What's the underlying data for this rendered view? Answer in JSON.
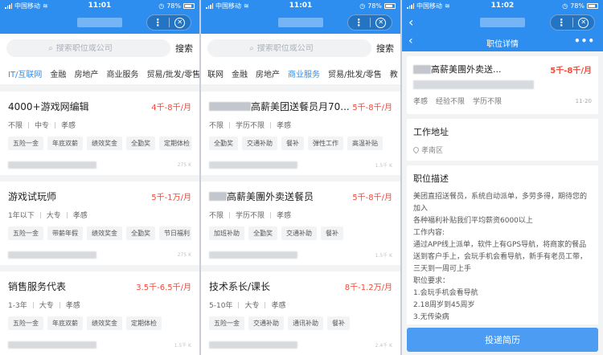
{
  "status": {
    "carrier": "中国移动",
    "battery": "78%",
    "time_1": "11:01",
    "time_2": "11:01",
    "time_3": "11:02"
  },
  "capsule": {
    "more": "⋮",
    "close": "✕"
  },
  "search": {
    "placeholder": "搜索职位或公司",
    "button": "搜索"
  },
  "tabs_panel1": [
    "IT/互联网",
    "金融",
    "房地产",
    "商业服务",
    "贸易/批发/零售"
  ],
  "tabs_panel2": [
    "联网",
    "金融",
    "房地产",
    "商业服务",
    "贸易/批发/零售",
    "教"
  ],
  "jobs_panel1": [
    {
      "title": "4000+游戏网编辑",
      "salary": "4千-8千/月",
      "meta": [
        "不限",
        "中专",
        "孝感"
      ],
      "tags": [
        "五险一金",
        "年底双薪",
        "绩效奖金",
        "全勤奖",
        "定期体检"
      ],
      "dist": "275 K"
    },
    {
      "title": "游戏试玩师",
      "salary": "5千-1万/月",
      "meta": [
        "1年以下",
        "大专",
        "孝感"
      ],
      "tags": [
        "五险一金",
        "带薪年假",
        "绩效奖金",
        "全勤奖",
        "节日福利"
      ],
      "dist": "275 K"
    },
    {
      "title": "销售服务代表",
      "salary": "3.5千-6.5千/月",
      "meta": [
        "1-3年",
        "大专",
        "孝感"
      ],
      "tags": [
        "五险一金",
        "年底双薪",
        "绩效奖金",
        "定期体检"
      ],
      "dist": "1.5千 K"
    }
  ],
  "jobs_panel2": [
    {
      "title": "高薪美团送餐员月70...",
      "salary": "5千-8千/月",
      "meta": [
        "不限",
        "学历不限",
        "孝感"
      ],
      "tags": [
        "全勤奖",
        "交通补助",
        "餐补",
        "弹性工作",
        "高温补贴"
      ],
      "dist": "1.5千 K"
    },
    {
      "title": "高薪美團外卖送餐员",
      "salary": "5千-8千/月",
      "meta": [
        "不限",
        "学历不限",
        "孝感"
      ],
      "tags": [
        "加班补助",
        "全勤奖",
        "交通补助",
        "餐补"
      ],
      "dist": "1.5千 K"
    },
    {
      "title": "技术系长/课长",
      "salary": "8千-1.2万/月",
      "meta": [
        "5-10年",
        "大专",
        "孝感"
      ],
      "tags": [
        "五险一金",
        "交通补助",
        "通讯补助",
        "餐补"
      ],
      "dist": "2.4千 K"
    }
  ],
  "detail": {
    "nav_title": "职位详情",
    "more": "•••",
    "job_title": "高薪美團外卖送...",
    "salary": "5千-8千/月",
    "meta": [
      "孝感",
      "经验不限",
      "学历不限"
    ],
    "date": "11-20",
    "address_title": "工作地址",
    "address": "孝南区",
    "desc_title": "职位描述",
    "desc_lines": [
      "美团直招送餐员，系统自动派单，多劳多得，期待您的加入",
      "各种福利补贴我们平均薪资6000以上",
      "工作内容:",
      "通过APP线上派单，软件上有GPS导航，将商家的餐品送到客户手上，会玩手机会看导航，新手有老员工带，三天到一周可上手",
      "职位要求：",
      "1.会玩手机会看导航",
      "2.18周岁到45周岁",
      "3.无传染病"
    ],
    "apply": "投递简历"
  }
}
